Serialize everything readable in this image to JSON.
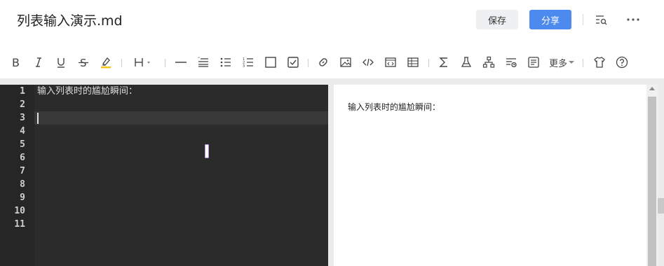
{
  "header": {
    "file_title": "列表输入演示.md",
    "save_label": "保存",
    "share_label": "分享",
    "icons": [
      "outline-search-icon",
      "more-icon"
    ]
  },
  "toolbar": {
    "items": [
      "bold-icon",
      "italic-icon",
      "underline-icon",
      "strikethrough-icon",
      "highlight-icon",
      "heading-icon",
      "hr-icon",
      "blockquote-icon",
      "bullet-list-icon",
      "ordered-list-icon",
      "checkbox-icon",
      "checked-box-icon",
      "link-icon",
      "image-icon",
      "code-icon",
      "code-block-icon",
      "table-icon",
      "formula-icon",
      "flask-icon",
      "flowchart-icon",
      "toc-icon",
      "template-icon",
      "theme-icon",
      "help-icon"
    ],
    "more_label": "更多",
    "highlight_color": "#f5c518"
  },
  "editor": {
    "line_numbers": [
      "1",
      "2",
      "3",
      "4",
      "5",
      "6",
      "7",
      "8",
      "9",
      "10",
      "11"
    ],
    "lines": [
      "输入列表时的尴尬瞬间：",
      "",
      ""
    ],
    "active_line": 3
  },
  "preview": {
    "paragraph": "输入列表时的尴尬瞬间："
  },
  "colors": {
    "accent": "#4d8af0",
    "editor_bg": "#2b2b2b"
  }
}
